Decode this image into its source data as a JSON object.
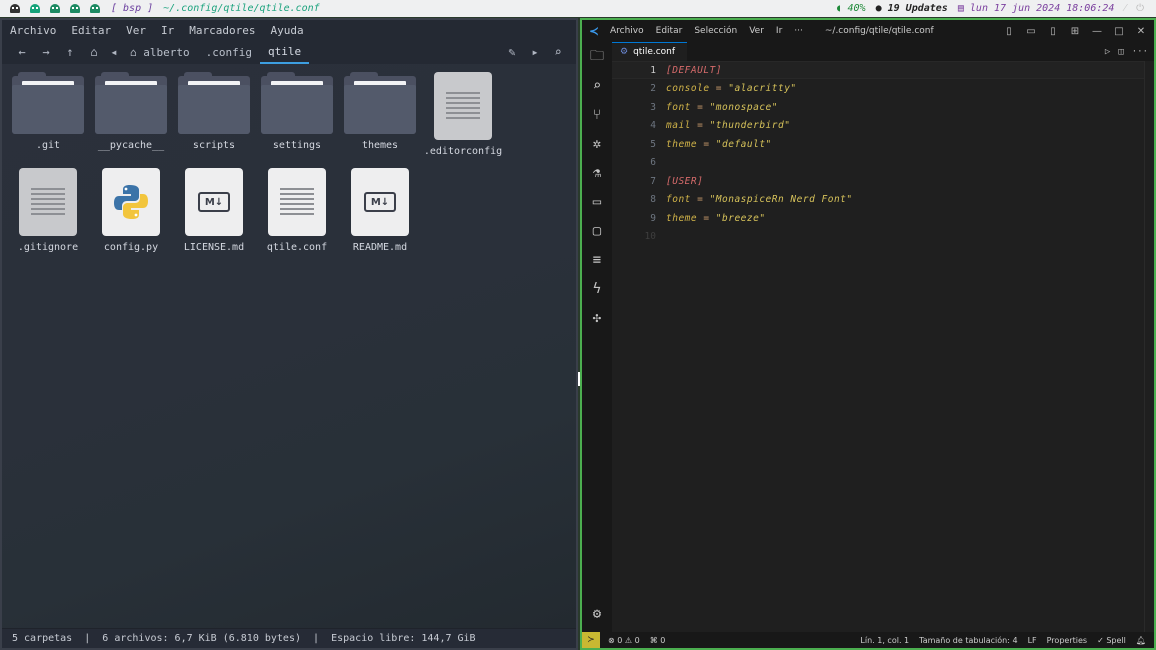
{
  "topbar": {
    "layout": "[ bsp ]",
    "path": "~/.config/qtile/qtile.conf",
    "battery": "40%",
    "updates": "19 Updates",
    "datetime": "lun 17 jun 2024 18:06:24"
  },
  "file_manager": {
    "menu": [
      "Archivo",
      "Editar",
      "Ver",
      "Ir",
      "Marcadores",
      "Ayuda"
    ],
    "breadcrumb": [
      "alberto",
      ".config",
      "qtile"
    ],
    "folders": [
      ".git",
      "__pycache__",
      "scripts",
      "settings",
      "themes"
    ],
    "files": [
      {
        "name": ".editorconfig",
        "icon": "text-file-icon"
      },
      {
        "name": ".gitignore",
        "icon": "text-file-icon"
      },
      {
        "name": "config.py",
        "icon": "python-file-icon"
      },
      {
        "name": "LICENSE.md",
        "icon": "markdown-file-icon"
      },
      {
        "name": "qtile.conf",
        "icon": "text-file-icon"
      },
      {
        "name": "README.md",
        "icon": "markdown-file-icon"
      }
    ],
    "status": "5 carpetas  |  6 archivos: 6,7 KiB (6.810 bytes)  |  Espacio libre: 144,7 GiB"
  },
  "vscode": {
    "menu": [
      "Archivo",
      "Editar",
      "Selección",
      "Ver",
      "Ir",
      "···"
    ],
    "title": "~/.config/qtile/qtile.conf",
    "tab": "qtile.conf",
    "lines": [
      {
        "n": "1",
        "text": "[DEFAULT]"
      },
      {
        "n": "2",
        "text": "console = \"alacritty\""
      },
      {
        "n": "3",
        "text": "font = \"monospace\""
      },
      {
        "n": "4",
        "text": "mail = \"thunderbird\""
      },
      {
        "n": "5",
        "text": "theme = \"default\""
      },
      {
        "n": "6",
        "text": ""
      },
      {
        "n": "7",
        "text": "[USER]"
      },
      {
        "n": "8",
        "text": "font = \"MonaspiceRn Nerd Font\""
      },
      {
        "n": "9",
        "text": "theme = \"breeze\""
      },
      {
        "n": "10",
        "text": ""
      }
    ],
    "status": {
      "errors": "0",
      "warnings": "0",
      "ports": "0",
      "position": "Lín. 1, col. 1",
      "tab_size": "Tamaño de tabulación: 4",
      "eol": "LF",
      "language": "Properties",
      "spell": "Spell"
    }
  }
}
